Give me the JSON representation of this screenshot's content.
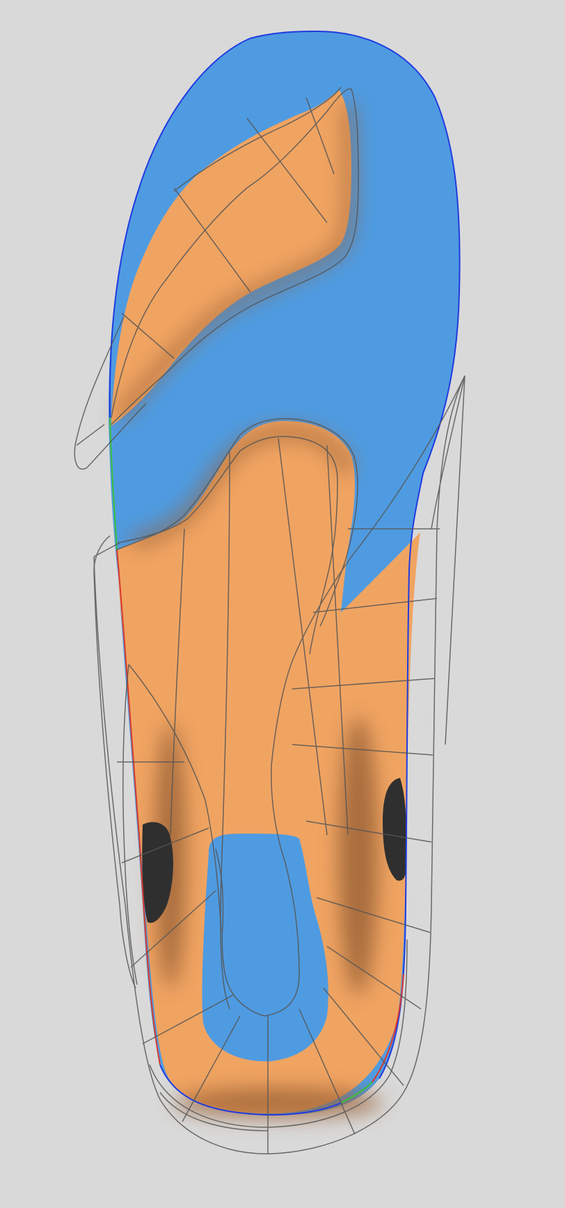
{
  "viewport": {
    "title": "",
    "model": "insole-3d-view"
  },
  "colors": {
    "background": "#d9d9d9",
    "surface_base": "#4f9be1",
    "pressure_zone": "#f0a462",
    "pressure_shadow": "#b9774a",
    "contact_point": "#2f2f2f",
    "wireframe": "#555555",
    "outline_medial": "#1f3be0",
    "outline_lateral": "#d83a2e",
    "outline_highlight": "#3bbf3b"
  }
}
